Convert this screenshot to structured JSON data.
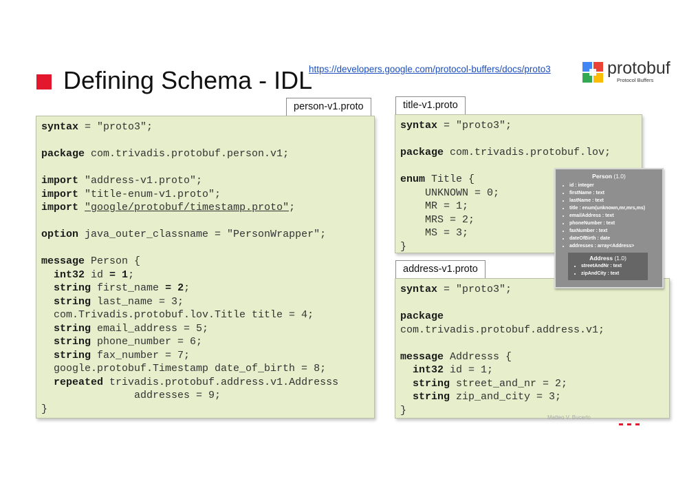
{
  "slide": {
    "title": "Defining Schema - IDL",
    "link_text": "https://developers.google.com/protocol-buffers/docs/proto3",
    "logo": {
      "word": "protobuf",
      "subtitle": "Protocol Buffers",
      "icon": "protobuf-logo-icon"
    },
    "accent_color": "#e3182d",
    "footer_text": "Matteo V. Bucerlo"
  },
  "files": [
    {
      "name": "person-v1.proto",
      "lines": [
        [
          {
            "t": "syntax",
            "b": true
          },
          {
            "t": " = \"proto3\";"
          }
        ],
        [],
        [
          {
            "t": "package",
            "b": true
          },
          {
            "t": " com.trivadis.protobuf.person.v1;"
          }
        ],
        [],
        [
          {
            "t": "import",
            "b": true
          },
          {
            "t": " \"address-v1.proto\";"
          }
        ],
        [
          {
            "t": "import",
            "b": true
          },
          {
            "t": " \"title-enum-v1.proto\";"
          }
        ],
        [
          {
            "t": "import",
            "b": true
          },
          {
            "t": " "
          },
          {
            "t": "\"google/protobuf/timestamp.proto\"",
            "u": true
          },
          {
            "t": ";"
          }
        ],
        [],
        [
          {
            "t": "option",
            "b": true
          },
          {
            "t": " java_outer_classname = \"PersonWrapper\";"
          }
        ],
        [],
        [
          {
            "t": "message",
            "b": true
          },
          {
            "t": " Person {"
          }
        ],
        [
          {
            "t": "  "
          },
          {
            "t": "int32",
            "b": true
          },
          {
            "t": " id "
          },
          {
            "t": "= 1",
            "b": true
          },
          {
            "t": ";"
          }
        ],
        [
          {
            "t": "  "
          },
          {
            "t": "string",
            "b": true
          },
          {
            "t": " first_name "
          },
          {
            "t": "= 2",
            "b": true
          },
          {
            "t": ";"
          }
        ],
        [
          {
            "t": "  "
          },
          {
            "t": "string",
            "b": true
          },
          {
            "t": " last_name = 3;"
          }
        ],
        [
          {
            "t": "  com.Trivadis.protobuf.lov.Title title = 4;"
          }
        ],
        [
          {
            "t": "  "
          },
          {
            "t": "string",
            "b": true
          },
          {
            "t": " email_address = 5;"
          }
        ],
        [
          {
            "t": "  "
          },
          {
            "t": "string",
            "b": true
          },
          {
            "t": " phone_number = 6;"
          }
        ],
        [
          {
            "t": "  "
          },
          {
            "t": "string",
            "b": true
          },
          {
            "t": " fax_number = 7;"
          }
        ],
        [
          {
            "t": "  google.protobuf.Timestamp date_of_birth = 8;"
          }
        ],
        [
          {
            "t": "  "
          },
          {
            "t": "repeated",
            "b": true
          },
          {
            "t": " trivadis.protobuf.address.v1.Addresss"
          }
        ],
        [
          {
            "t": "               addresses = 9;"
          }
        ],
        [
          {
            "t": "}"
          }
        ]
      ]
    },
    {
      "name": "title-v1.proto",
      "lines": [
        [
          {
            "t": "syntax",
            "b": true
          },
          {
            "t": " = \"proto3\";"
          }
        ],
        [],
        [
          {
            "t": "package",
            "b": true
          },
          {
            "t": " com.trivadis.protobuf.lov;"
          }
        ],
        [],
        [
          {
            "t": "enum",
            "b": true
          },
          {
            "t": " Title {"
          }
        ],
        [
          {
            "t": "    UNKNOWN = 0;"
          }
        ],
        [
          {
            "t": "    MR = 1;"
          }
        ],
        [
          {
            "t": "    MRS = 2;"
          }
        ],
        [
          {
            "t": "    MS = 3;"
          }
        ],
        [
          {
            "t": "}"
          }
        ]
      ]
    },
    {
      "name": "address-v1.proto",
      "lines": [
        [
          {
            "t": "syntax",
            "b": true
          },
          {
            "t": " = \"proto3\";"
          }
        ],
        [],
        [
          {
            "t": "package",
            "b": true
          }
        ],
        [
          {
            "t": "com.trivadis.protobuf.address.v1;"
          }
        ],
        [],
        [
          {
            "t": "message",
            "b": true
          },
          {
            "t": " Addresss {"
          }
        ],
        [
          {
            "t": "  "
          },
          {
            "t": "int32",
            "b": true
          },
          {
            "t": " id = 1;"
          }
        ],
        [
          {
            "t": "  "
          },
          {
            "t": "string",
            "b": true
          },
          {
            "t": " street_and_nr = 2;"
          }
        ],
        [
          {
            "t": "  "
          },
          {
            "t": "string",
            "b": true
          },
          {
            "t": " zip_and_city = 3;"
          }
        ],
        [
          {
            "t": "}"
          }
        ]
      ]
    }
  ],
  "schema_card": {
    "name": "Person",
    "version": "(1.0)",
    "fields": [
      "id : integer",
      "firstName : text",
      "lastName : text",
      "title : enum(unknown,mr,mrs,ms)",
      "emailAddress : text",
      "phoneNumber : text",
      "faxNumber : text",
      "dateOfBirth : date",
      "addresses : array<Address>"
    ],
    "nested": {
      "name": "Address",
      "version": "(1.0)",
      "fields": [
        "streetAndNr : text",
        "zipAndCity : text"
      ]
    }
  }
}
